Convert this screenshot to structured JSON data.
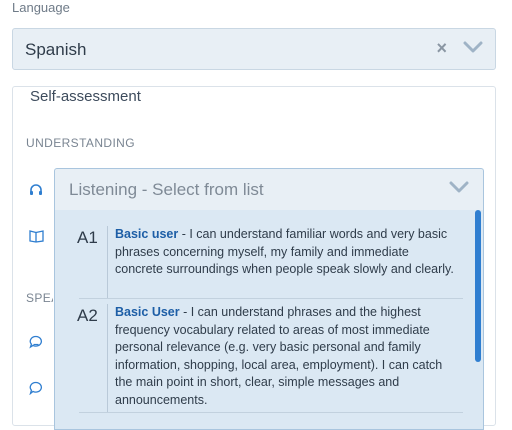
{
  "language": {
    "label": "Language",
    "value": "Spanish"
  },
  "self_assessment": {
    "legend": "Self-assessment",
    "sections": [
      {
        "heading": "UNDERSTANDING"
      },
      {
        "heading": "SPEAKING"
      }
    ],
    "listening": {
      "placeholder": "Listening - Select from list",
      "options": [
        {
          "level": "A1",
          "title": "Basic user",
          "description": " - I can understand familiar words and very basic phrases concerning myself, my family and immediate concrete surroundings when people speak slowly and clearly."
        },
        {
          "level": "A2",
          "title": "Basic User",
          "description": " - I can understand phrases and the highest frequency vocabulary related to areas of most immediate personal relevance (e.g. very basic personal and family information, shopping, local area, employment). I can catch the main point in short, clear, simple messages and announcements."
        }
      ]
    }
  },
  "colors": {
    "select_bg": "#e8eff5",
    "dropdown_bg": "#dbe8f3",
    "link_blue": "#1d5ea6",
    "scrollbar": "#2f7ed0",
    "icon_blue": "#2f7ed0"
  },
  "icons": [
    "clear-icon",
    "chevron-down-icon",
    "headphones-icon",
    "book-icon",
    "speech-bubble-icon",
    "chat-bubble-icon"
  ]
}
